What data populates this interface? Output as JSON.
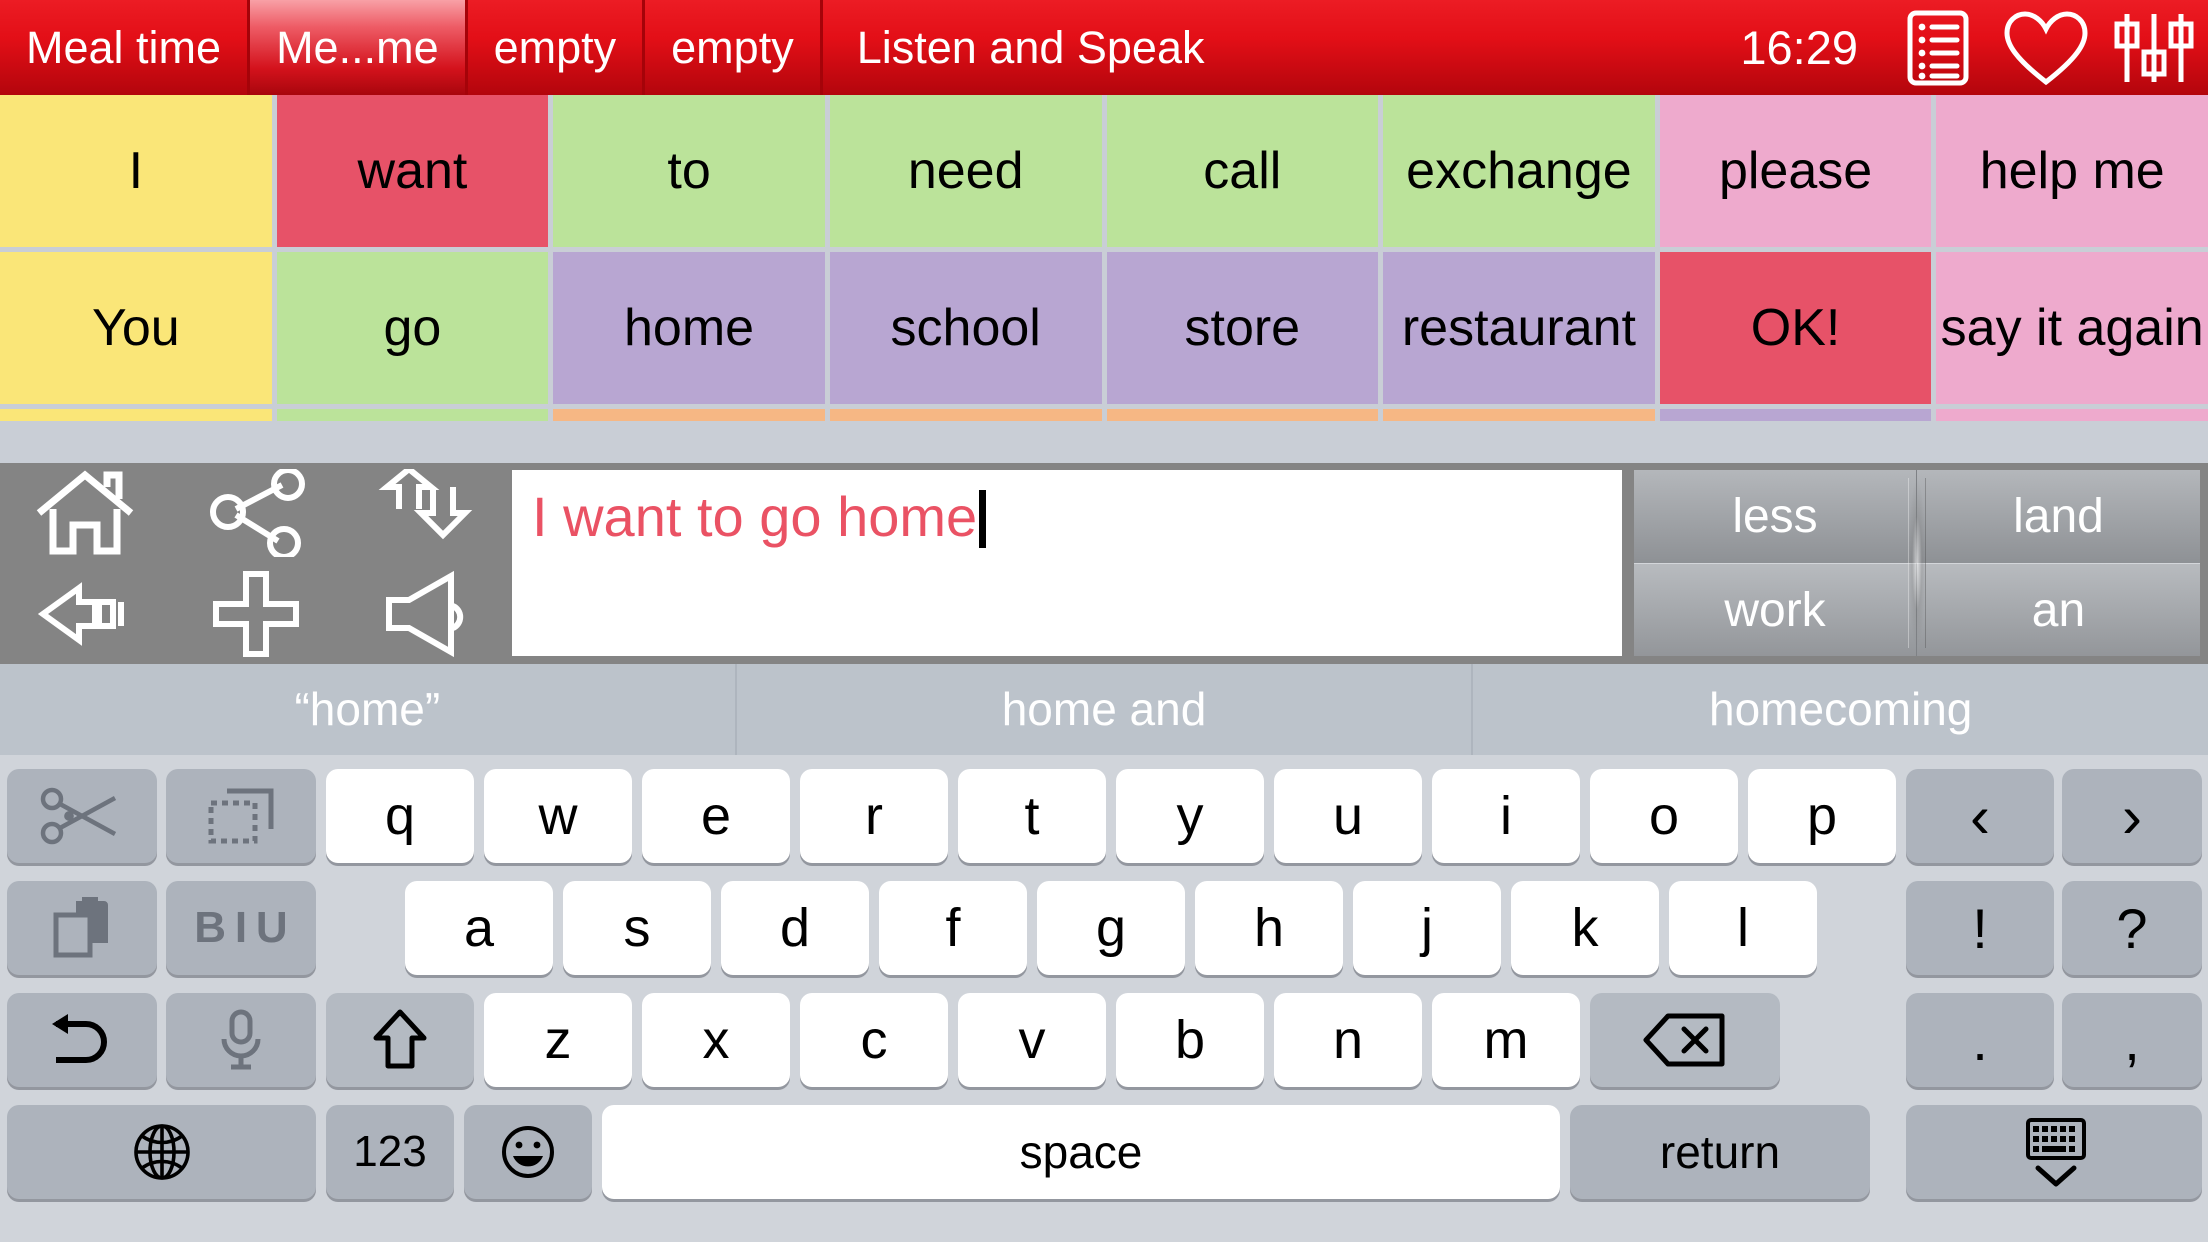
{
  "topbar": {
    "tabs": [
      {
        "label": "Meal time",
        "active": false
      },
      {
        "label": "Me...me",
        "active": true
      },
      {
        "label": "empty",
        "active": false
      },
      {
        "label": "empty",
        "active": false
      },
      {
        "label": "Listen and Speak",
        "active": false
      }
    ],
    "clock": "16:29",
    "icons": [
      "list-icon",
      "heart-icon",
      "equalizer-icon"
    ],
    "accent_color": "#e30f17"
  },
  "grid": {
    "row1": [
      {
        "label": "I",
        "color": "#fae678"
      },
      {
        "label": "want",
        "color": "#e75268"
      },
      {
        "label": "to",
        "color": "#bbe39a"
      },
      {
        "label": "need",
        "color": "#bbe39a"
      },
      {
        "label": "call",
        "color": "#bbe39a"
      },
      {
        "label": "exchange",
        "color": "#bbe39a"
      },
      {
        "label": "please",
        "color": "#eeaacd"
      },
      {
        "label": "help me",
        "color": "#eeaacd"
      }
    ],
    "row2": [
      {
        "label": "You",
        "color": "#fae678"
      },
      {
        "label": "go",
        "color": "#bbe39a"
      },
      {
        "label": "home",
        "color": "#b8a6d2"
      },
      {
        "label": "school",
        "color": "#b8a6d2"
      },
      {
        "label": "store",
        "color": "#b8a6d2"
      },
      {
        "label": "restaurant",
        "color": "#b8a6d2"
      },
      {
        "label": "OK!",
        "color": "#e75268"
      },
      {
        "label": "say it again",
        "color": "#eeaacd"
      }
    ],
    "row3_strip": [
      {
        "color": "#fae678"
      },
      {
        "color": "#bbe39a"
      },
      {
        "color": "#f6b784"
      },
      {
        "color": "#f6b784"
      },
      {
        "color": "#f6b784"
      },
      {
        "color": "#f6b784"
      },
      {
        "color": "#b8a6d2"
      },
      {
        "color": "#eeaacd"
      }
    ]
  },
  "compose": {
    "tools": [
      "home-icon",
      "share-icon",
      "updown-arrows-icon",
      "backspace-arrow-icon",
      "plus-icon",
      "speaker-icon"
    ],
    "text": "I want to go home",
    "text_color": "#ea5264",
    "predictions": [
      "less",
      "land",
      "work",
      "an"
    ]
  },
  "suggestions": [
    "“home”",
    "home and",
    "homecoming"
  ],
  "keyboard": {
    "left_column": [
      {
        "name": "cut-icon",
        "label": ""
      },
      {
        "name": "select-icon",
        "label": ""
      },
      {
        "name": "paste-icon",
        "label": ""
      },
      {
        "name": "format-biu-icon",
        "label": "B I U"
      },
      {
        "name": "undo-icon",
        "label": ""
      },
      {
        "name": "microphone-icon",
        "label": ""
      },
      {
        "name": "globe-icon",
        "label": ""
      }
    ],
    "row1": [
      "q",
      "w",
      "e",
      "r",
      "t",
      "y",
      "u",
      "i",
      "o",
      "p"
    ],
    "row2": [
      "a",
      "s",
      "d",
      "f",
      "g",
      "h",
      "j",
      "k",
      "l"
    ],
    "row3": [
      "z",
      "x",
      "c",
      "v",
      "b",
      "n",
      "m"
    ],
    "shift_key": "shift-icon",
    "backspace_key": "backspace-icon",
    "numbers_key": "123",
    "emoji_key": "emoji-icon",
    "space_key": "space",
    "return_key": "return",
    "hide_keyboard_key": "hide-keyboard-icon",
    "right_column": [
      {
        "name": "prev-key",
        "label": "‹"
      },
      {
        "name": "next-key",
        "label": "›"
      },
      {
        "name": "exclamation-key",
        "label": "!"
      },
      {
        "name": "question-key",
        "label": "?"
      },
      {
        "name": "period-key",
        "label": "."
      },
      {
        "name": "comma-key",
        "label": ","
      }
    ]
  }
}
